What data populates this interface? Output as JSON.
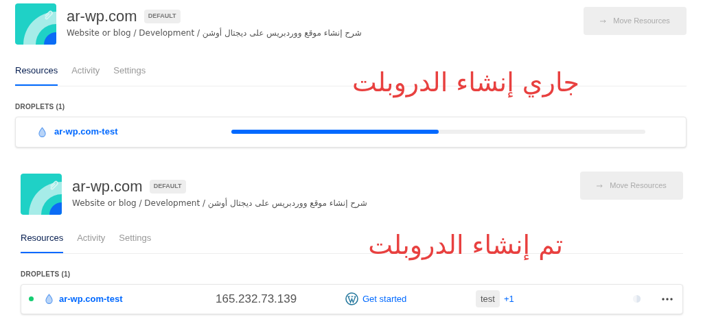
{
  "panels": [
    {
      "project": {
        "title": "ar-wp.com",
        "badge": "DEFAULT",
        "subtitle": "Website or blog / Development / شرح إنشاء موقع ووردبريس على ديجتال أوشن"
      },
      "move_button": {
        "label": "Move Resources",
        "disabled": true
      },
      "tabs": [
        {
          "label": "Resources",
          "selected": true
        },
        {
          "label": "Activity",
          "selected": false
        },
        {
          "label": "Settings",
          "selected": false
        }
      ],
      "annotation": "جاري إنشاء الدروبلت",
      "section_title": "DROPLETS (1)",
      "droplets": [
        {
          "kind": "creating",
          "name": "ar-wp.com-test",
          "level": 0.5
        }
      ]
    },
    {
      "project": {
        "title": "ar-wp.com",
        "badge": "DEFAULT",
        "subtitle": "Website or blog / Development / شرح إنشاء موقع ووردبريس على ديجتال أوشن"
      },
      "move_button": {
        "label": "Move Resources",
        "disabled": true
      },
      "tabs": [
        {
          "label": "Resources",
          "selected": true
        },
        {
          "label": "Activity",
          "selected": false
        },
        {
          "label": "Settings",
          "selected": false
        }
      ],
      "annotation": "تم إنشاء الدروبلت",
      "section_title": "DROPLETS (1)",
      "droplets": [
        {
          "kind": "ready",
          "running": true,
          "name": "ar-wp.com-test",
          "ip": "165.232.73.139",
          "action": "Get started",
          "tag": "test",
          "more_tags": "+1"
        }
      ]
    }
  ]
}
